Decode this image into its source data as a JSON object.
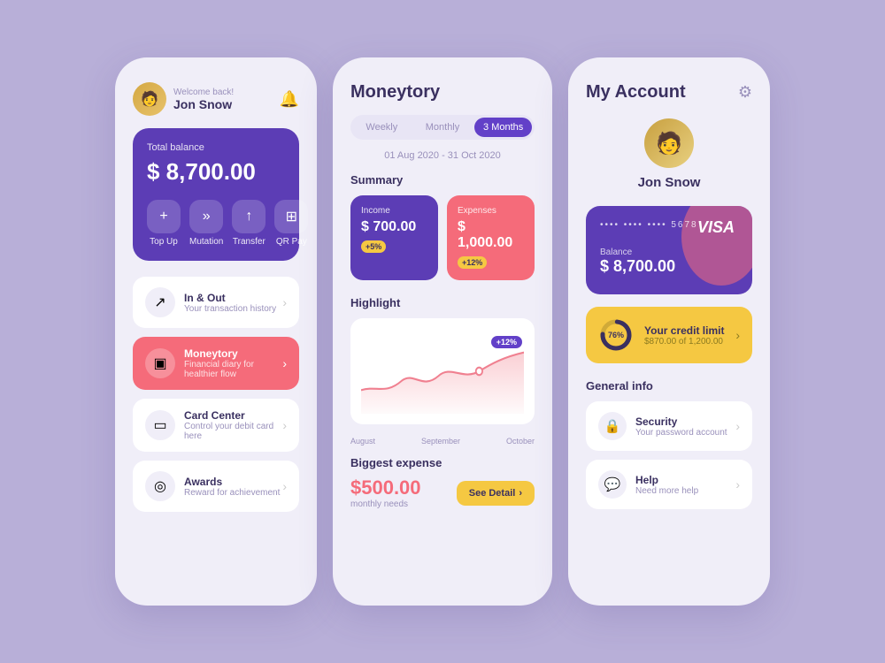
{
  "app": {
    "background": "#b8afd8"
  },
  "left_phone": {
    "welcome_text": "Welcome back!",
    "user_name": "Jon Snow",
    "balance_label": "Total balance",
    "balance_amount": "$ 8,700.00",
    "actions": [
      {
        "label": "Top Up",
        "icon": "+"
      },
      {
        "label": "Mutation",
        "icon": "»"
      },
      {
        "label": "Transfer",
        "icon": "↑"
      },
      {
        "label": "QR Pay",
        "icon": "▦"
      }
    ],
    "menu_items": [
      {
        "title": "In & Out",
        "subtitle": "Your transaction history",
        "icon": "↗",
        "active": false
      },
      {
        "title": "Moneytory",
        "subtitle": "Financial diary for healthier flow",
        "icon": "▣",
        "active": true
      },
      {
        "title": "Card Center",
        "subtitle": "Control your debit card here",
        "icon": "▭",
        "active": false
      },
      {
        "title": "Awards",
        "subtitle": "Reward for achievement",
        "icon": "◎",
        "active": false
      }
    ]
  },
  "center_phone": {
    "title": "Moneytory",
    "tabs": [
      {
        "label": "Weekly",
        "active": false
      },
      {
        "label": "Monthly",
        "active": false
      },
      {
        "label": "3 Months",
        "active": true
      }
    ],
    "date_range": "01 Aug 2020 - 31 Oct 2020",
    "summary_title": "Summary",
    "income": {
      "label": "Income",
      "amount": "$ 700.00",
      "badge": "+5%"
    },
    "expenses": {
      "label": "Expenses",
      "amount": "$ 1,000.00",
      "badge": "+12%"
    },
    "highlight_title": "Highlight",
    "chart_badge": "+12%",
    "chart_labels": [
      "August",
      "September",
      "October"
    ],
    "biggest_expense_title": "Biggest expense",
    "biggest_expense_amount": "$500.00",
    "biggest_expense_type": "monthly needs",
    "see_detail_btn": "See Detail"
  },
  "right_phone": {
    "title": "My Account",
    "user_name": "Jon Snow",
    "card_number": "•••• •••• •••• 5678",
    "card_brand": "VISA",
    "card_balance_label": "Balance",
    "card_balance_amount": "$ 8,700.00",
    "credit_limit_title": "Your credit limit",
    "credit_limit_sub": "$870.00 of 1,200.00",
    "credit_pct": "76%",
    "general_info_title": "General info",
    "info_items": [
      {
        "title": "Security",
        "subtitle": "Your password account",
        "icon": "🔒"
      },
      {
        "title": "Help",
        "subtitle": "Need more help",
        "icon": "💬"
      }
    ]
  }
}
